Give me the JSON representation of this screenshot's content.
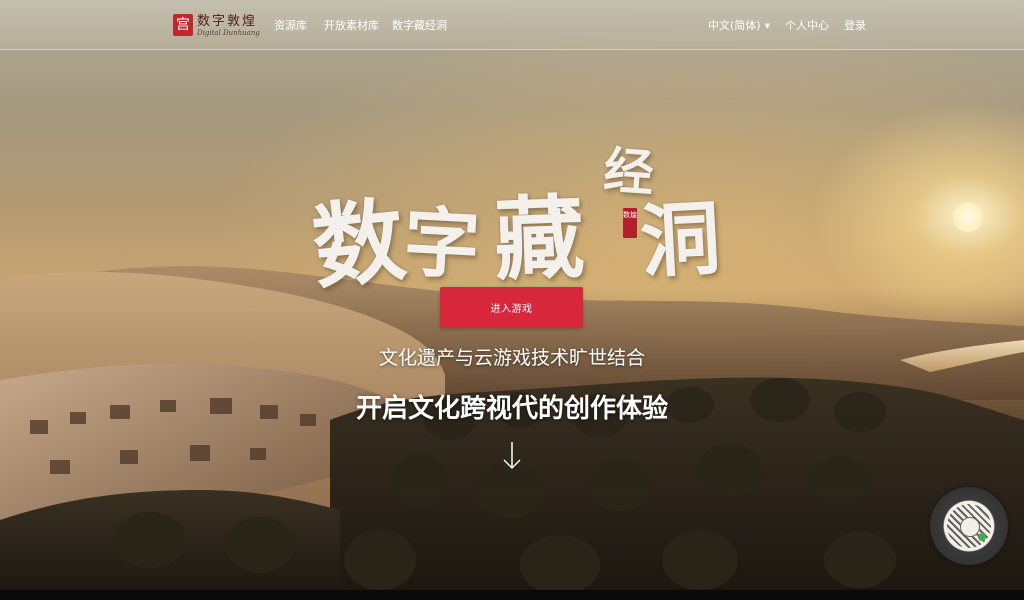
{
  "nav": {
    "logo_seal": "宫",
    "logo_cn": "数字敦煌",
    "logo_en": "Digital Dunhuang",
    "links": [
      "资源库",
      "开放素材库",
      "数字藏经洞"
    ],
    "language": "中文(简体)",
    "user_center": "个人中心",
    "login": "登录"
  },
  "hero": {
    "calligraphy_chars": [
      "数",
      "字",
      "藏",
      "经",
      "洞"
    ],
    "calligraphy_seal": "数煌",
    "enter_button": "进入游戏",
    "subtitle": "文化遗产与云游戏技术旷世结合",
    "headline": "开启文化跨视代的创作体验"
  },
  "icons": {
    "scroll_down": "arrow-down-icon",
    "qr": "qr-code-icon",
    "language_caret": "caret-down-icon"
  },
  "colors": {
    "accent_red": "#d8263a",
    "seal_red": "#c0282d"
  }
}
